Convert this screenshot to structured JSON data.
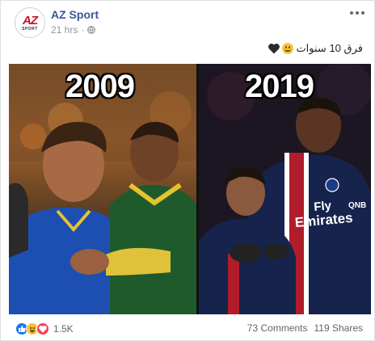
{
  "post": {
    "page_name": "AZ Sport",
    "time": "21 hrs",
    "privacy_icon": "globe-icon",
    "caption_text": "فرق 10 سنوات",
    "caption_emojis": [
      "smiling-face-icon",
      "black-heart-icon"
    ]
  },
  "avatar": {
    "mark": "AZ",
    "sub": "SPORT"
  },
  "photo": {
    "left_year": "2009",
    "right_year": "2019",
    "jersey_line1": "Fly",
    "jersey_line2": "Emirates",
    "jersey_sponsor": "QNB"
  },
  "footer": {
    "reaction_icons": [
      "like-icon",
      "haha-icon",
      "love-icon"
    ],
    "reaction_count": "1.5K",
    "comments": "73 Comments",
    "shares": "119 Shares"
  },
  "colors": {
    "page_name": "#385898",
    "muted": "#90949c",
    "like": "#1877f2",
    "love": "#f33e58",
    "haha": "#f7c53a"
  }
}
